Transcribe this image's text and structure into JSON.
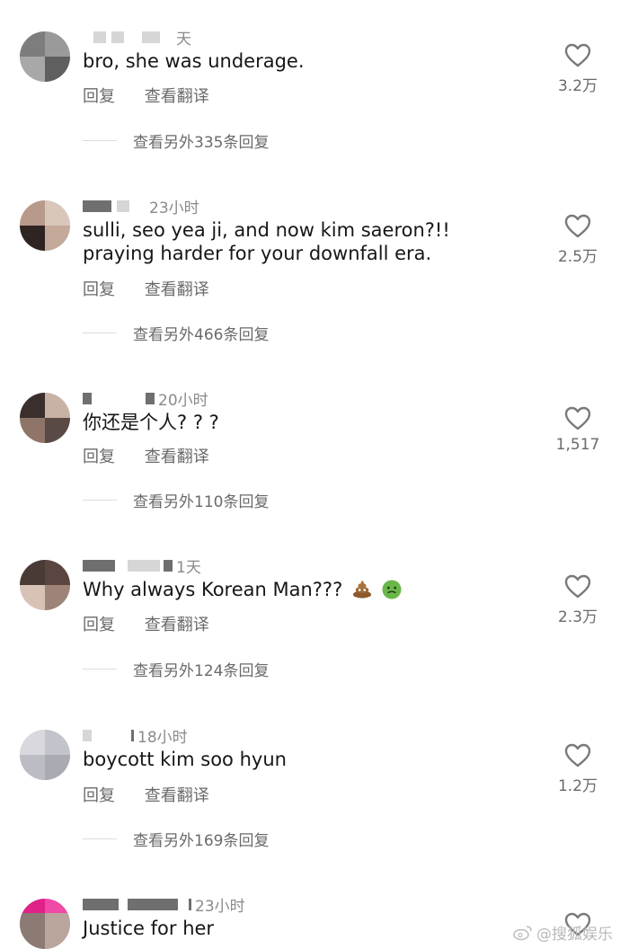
{
  "comments": [
    {
      "time": "天",
      "text": "bro, she was underage.",
      "reply_label": "回复",
      "translate_label": "查看翻译",
      "replies_label": "查看另外335条回复",
      "likes": "3.2万"
    },
    {
      "time": "23小时",
      "text": "sulli, seo yea ji, and now kim saeron?!! praying harder for your downfall era.",
      "reply_label": "回复",
      "translate_label": "查看翻译",
      "replies_label": "查看另外466条回复",
      "likes": "2.5万"
    },
    {
      "time": "20小时",
      "text": "你还是个人? ? ?",
      "reply_label": "回复",
      "translate_label": "查看翻译",
      "replies_label": "查看另外110条回复",
      "likes": "1,517"
    },
    {
      "time": "1天",
      "text": "Why always Korean Man???",
      "reply_label": "回复",
      "translate_label": "查看翻译",
      "replies_label": "查看另外124条回复",
      "likes": "2.3万"
    },
    {
      "time": "18小时",
      "text": "boycott kim soo hyun",
      "reply_label": "回复",
      "translate_label": "查看翻译",
      "replies_label": "查看另外169条回复",
      "likes": "1.2万"
    },
    {
      "time": "23小时",
      "text": "Justice for her",
      "likes": ""
    }
  ],
  "watermark": "@搜狐娱乐",
  "icons": [
    "heart-outline-icon",
    "poop-emoji-icon",
    "nauseated-face-emoji-icon",
    "weibo-logo-icon"
  ],
  "colors": {
    "text": "#161616",
    "secondary": "#6a6a6a",
    "meta": "#8a8a8a",
    "heart": "#7a7a7a"
  }
}
